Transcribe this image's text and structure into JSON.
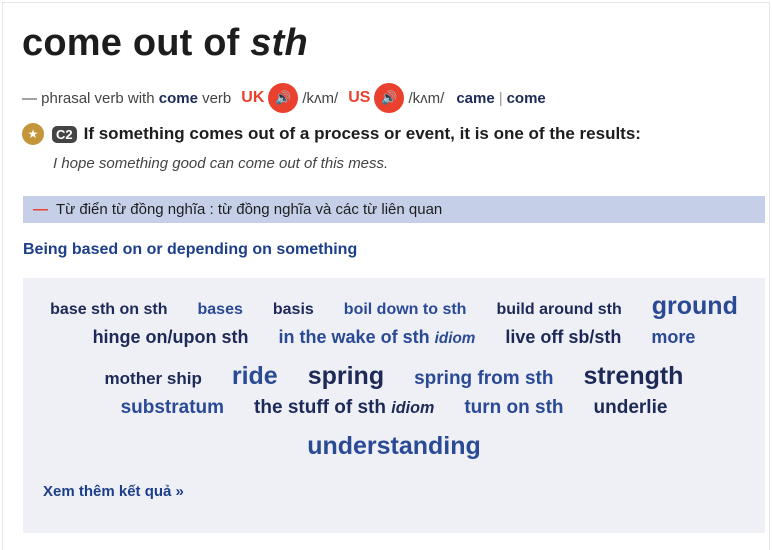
{
  "title": {
    "main": "come out of",
    "italic": "sth"
  },
  "pos": {
    "prefix": "— phrasal verb with",
    "headword": "come",
    "pos": "verb",
    "uk_label": "UK",
    "us_label": "US",
    "uk_ipa": "/kʌm/",
    "us_ipa": "/kʌm/",
    "forms": [
      "came",
      "come"
    ],
    "separator": "|",
    "speaker_icon": "speaker-icon"
  },
  "sense": {
    "level": "C2",
    "definition": "If something comes out of a process or event, it is one of the results:",
    "example": "I hope something good can come out of this mess.",
    "star_icon": "star-icon"
  },
  "thesaurus": {
    "bar_label": "Từ điển từ đồng nghĩa : từ đồng nghĩa và các từ liên quan",
    "group_title": "Being based on or depending on something",
    "see_more": "Xem thêm kết quả »",
    "colors": {
      "dark": "#1d2a57",
      "blue": "#2a4a96"
    },
    "rows": [
      [
        {
          "t": "base sth on sth",
          "c": "dark",
          "s": 16
        },
        {
          "t": "bases",
          "c": "blue",
          "s": 16
        },
        {
          "t": "basis",
          "c": "dark",
          "s": 16
        },
        {
          "t": "boil down to sth",
          "c": "blue",
          "s": 16
        },
        {
          "t": "build around sth",
          "c": "dark",
          "s": 16
        },
        {
          "t": "ground",
          "c": "blue",
          "s": 25
        }
      ],
      [
        {
          "t": "hinge on/upon sth",
          "c": "dark",
          "s": 18
        },
        {
          "t": "in the wake of sth",
          "tag": "idiom",
          "c": "blue",
          "s": 18
        },
        {
          "t": "live off sb/sth",
          "c": "dark",
          "s": 18
        },
        {
          "t": "more",
          "c": "blue",
          "s": 18
        }
      ],
      [
        {
          "t": "mother ship",
          "c": "dark",
          "s": 17
        },
        {
          "t": "ride",
          "c": "blue",
          "s": 25
        },
        {
          "t": "spring",
          "c": "dark",
          "s": 25
        },
        {
          "t": "spring from sth",
          "c": "blue",
          "s": 19
        },
        {
          "t": "strength",
          "c": "dark",
          "s": 25
        }
      ],
      [
        {
          "t": "substratum",
          "c": "blue",
          "s": 19
        },
        {
          "t": "the stuff of sth",
          "tag": "idiom",
          "c": "dark",
          "s": 19
        },
        {
          "t": "turn on sth",
          "c": "blue",
          "s": 19
        },
        {
          "t": "underlie",
          "c": "dark",
          "s": 19
        }
      ],
      [
        {
          "t": "understanding",
          "c": "blue",
          "s": 25
        }
      ]
    ]
  }
}
